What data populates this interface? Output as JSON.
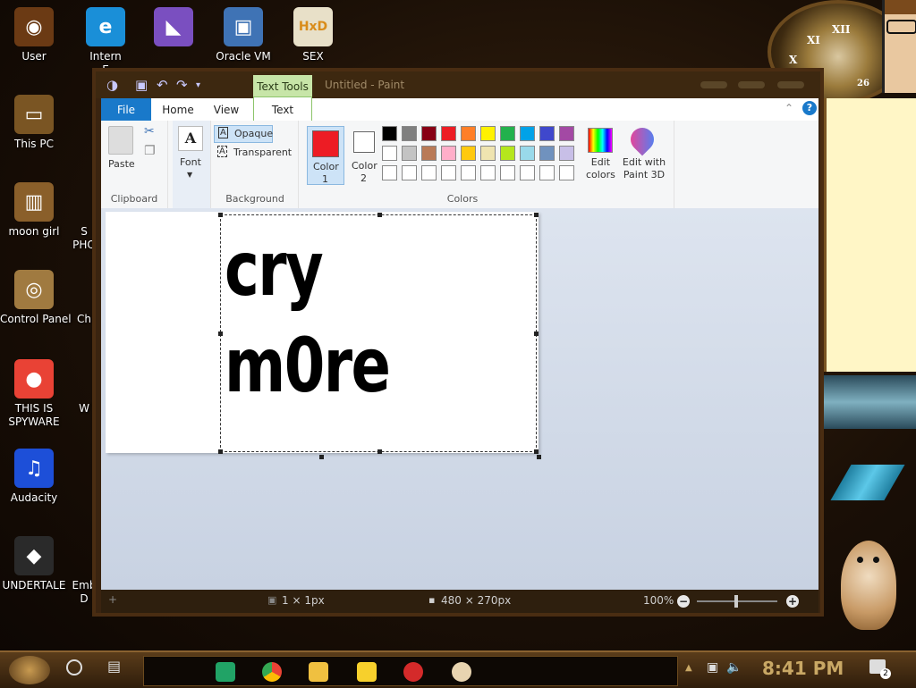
{
  "desktop": {
    "icons": [
      {
        "label": "User",
        "symbol": "◉",
        "color": "#6b3a14",
        "icon": "user-icon"
      },
      {
        "label": "Intern\nE",
        "symbol": "e",
        "color": "#1a8fd8",
        "icon": "edge-icon"
      },
      {
        "label": "",
        "symbol": "◣",
        "color": "#7a4fc0",
        "icon": "visual-studio-icon"
      },
      {
        "label": "Oracle VM",
        "symbol": "▣",
        "color": "#3f73b5",
        "icon": "virtualbox-icon"
      },
      {
        "label": "SEX",
        "symbol": "HxD",
        "color": "#e8e0c8",
        "icon": "hxd-icon"
      },
      {
        "label": "This PC",
        "symbol": "▭",
        "color": "#7a5523",
        "icon": "this-pc-icon"
      },
      {
        "label": "moon girl",
        "symbol": "▥",
        "color": "#8a5f2a",
        "icon": "folder-icon"
      },
      {
        "label": "Control Panel",
        "symbol": "◎",
        "color": "#a07a40",
        "icon": "control-panel-icon"
      },
      {
        "label": "THIS IS\nSPYWARE",
        "symbol": "●",
        "color": "#e94235",
        "icon": "chrome-icon"
      },
      {
        "label": "Audacity",
        "symbol": "♫",
        "color": "#1d4fd8",
        "icon": "audacity-icon"
      },
      {
        "label": "UNDERTALE",
        "symbol": "◆",
        "color": "#2a2a2a",
        "icon": "unity-icon"
      },
      {
        "label": "Emb\nD",
        "symbol": "",
        "color": "#4a2d12",
        "icon": "partial-icon"
      },
      {
        "label": "S\nPHO",
        "symbol": "",
        "color": "#4a2d12",
        "icon": "partial-icon"
      },
      {
        "label": "Ch",
        "symbol": "",
        "color": "#4a2d12",
        "icon": "partial-icon"
      },
      {
        "label": "W",
        "symbol": "",
        "color": "#4a2d12",
        "icon": "partial-icon"
      }
    ],
    "clock_numerals": [
      "XII",
      "XI",
      "X",
      "26"
    ]
  },
  "paint": {
    "contextual_tab": "Text Tools",
    "title": "Untitled - Paint",
    "tabs": [
      "File",
      "Home",
      "View",
      "Text"
    ],
    "clipboard": {
      "paste": "Paste",
      "group": "Clipboard"
    },
    "font": {
      "label": "Font"
    },
    "background": {
      "opaque": "Opaque",
      "transparent": "Transparent",
      "group": "Background"
    },
    "color1": {
      "label": "Color",
      "num": "1",
      "value": "#ed1c24"
    },
    "color2": {
      "label": "Color",
      "num": "2",
      "value": "#ffffff"
    },
    "colors_group": "Colors",
    "edit_colors": "Edit\ncolors",
    "edit_paint3d": "Edit with\nPaint 3D",
    "palette": [
      "#000000",
      "#7f7f7f",
      "#880015",
      "#ed1c24",
      "#ff7f27",
      "#fff200",
      "#22b14c",
      "#00a2e8",
      "#3f48cc",
      "#a349a4",
      "#ffffff",
      "#c3c3c3",
      "#b97a57",
      "#ffaec9",
      "#ffc90e",
      "#efe4b0",
      "#b5e61d",
      "#99d9ea",
      "#7092be",
      "#c8bfe7",
      "#ffffff",
      "#ffffff",
      "#ffffff",
      "#ffffff",
      "#ffffff",
      "#ffffff",
      "#ffffff",
      "#ffffff",
      "#ffffff",
      "#ffffff"
    ],
    "canvas_text": [
      "cry",
      "m0re"
    ],
    "status": {
      "selection": "1 × 1px",
      "size": "480 × 270px",
      "zoom": "100%"
    }
  },
  "taskbar": {
    "time": "8:41 PM",
    "notifications": "2"
  }
}
